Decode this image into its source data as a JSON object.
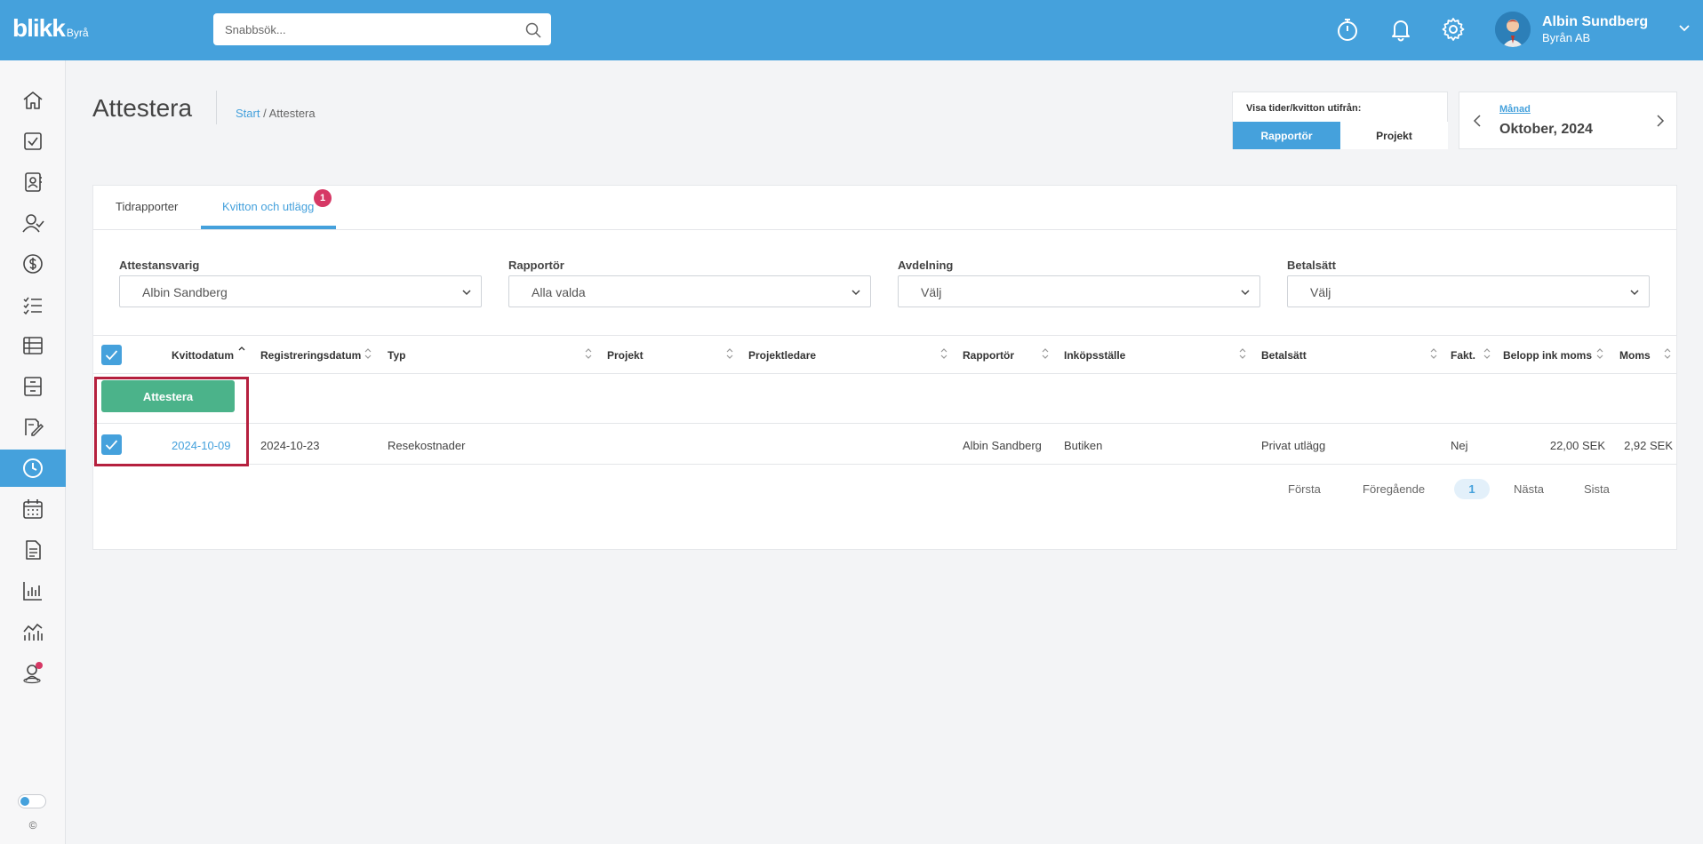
{
  "app": {
    "logo": "blikk",
    "logo_sub": "Byrå"
  },
  "search": {
    "placeholder": "Snabbsök..."
  },
  "user": {
    "name": "Albin Sundberg",
    "company": "Byrån AB"
  },
  "header": {
    "title": "Attestera",
    "breadcrumb_start": "Start",
    "breadcrumb_sep": " / ",
    "breadcrumb_current": "Attestera"
  },
  "view_toggle": {
    "label": "Visa tider/kvitton utifrån:",
    "options": [
      "Rapportör",
      "Projekt"
    ],
    "selected": "Rapportör"
  },
  "period": {
    "kind": "Månad",
    "value": "Oktober, 2024"
  },
  "tabs": [
    {
      "label": "Tidrapporter",
      "active": false
    },
    {
      "label": "Kvitton och utlägg",
      "active": true,
      "badge": "1"
    }
  ],
  "filters": [
    {
      "label": "Attestansvarig",
      "value": "Albin Sandberg"
    },
    {
      "label": "Rapportör",
      "value": "Alla valda"
    },
    {
      "label": "Avdelning",
      "value": "Välj"
    },
    {
      "label": "Betalsätt",
      "value": "Välj"
    }
  ],
  "table": {
    "columns": [
      "Kvittodatum",
      "Registreringsdatum",
      "Typ",
      "Projekt",
      "Projektledare",
      "Rapportör",
      "Inköpsställe",
      "Betalsätt",
      "Fakt.",
      "Belopp ink moms",
      "Moms"
    ],
    "action_button": "Attestera",
    "rows": [
      {
        "kvittodatum": "2024-10-09",
        "registreringsdatum": "2024-10-23",
        "typ": "Resekostnader",
        "projekt": "",
        "projektledare": "",
        "rapportor": "Albin Sandberg",
        "inkopsstalle": "Butiken",
        "betalsatt": "Privat utlägg",
        "fakt": "Nej",
        "belopp": "22,00 SEK",
        "moms": "2,92 SEK"
      }
    ]
  },
  "pagination": {
    "first": "Första",
    "prev": "Föregående",
    "current": "1",
    "next": "Nästa",
    "last": "Sista"
  },
  "footer": {
    "copyright": "©"
  },
  "colors": {
    "primary": "#45a1dc",
    "success": "#4bb38a",
    "badge": "#d63865",
    "highlight": "#b5203e"
  }
}
